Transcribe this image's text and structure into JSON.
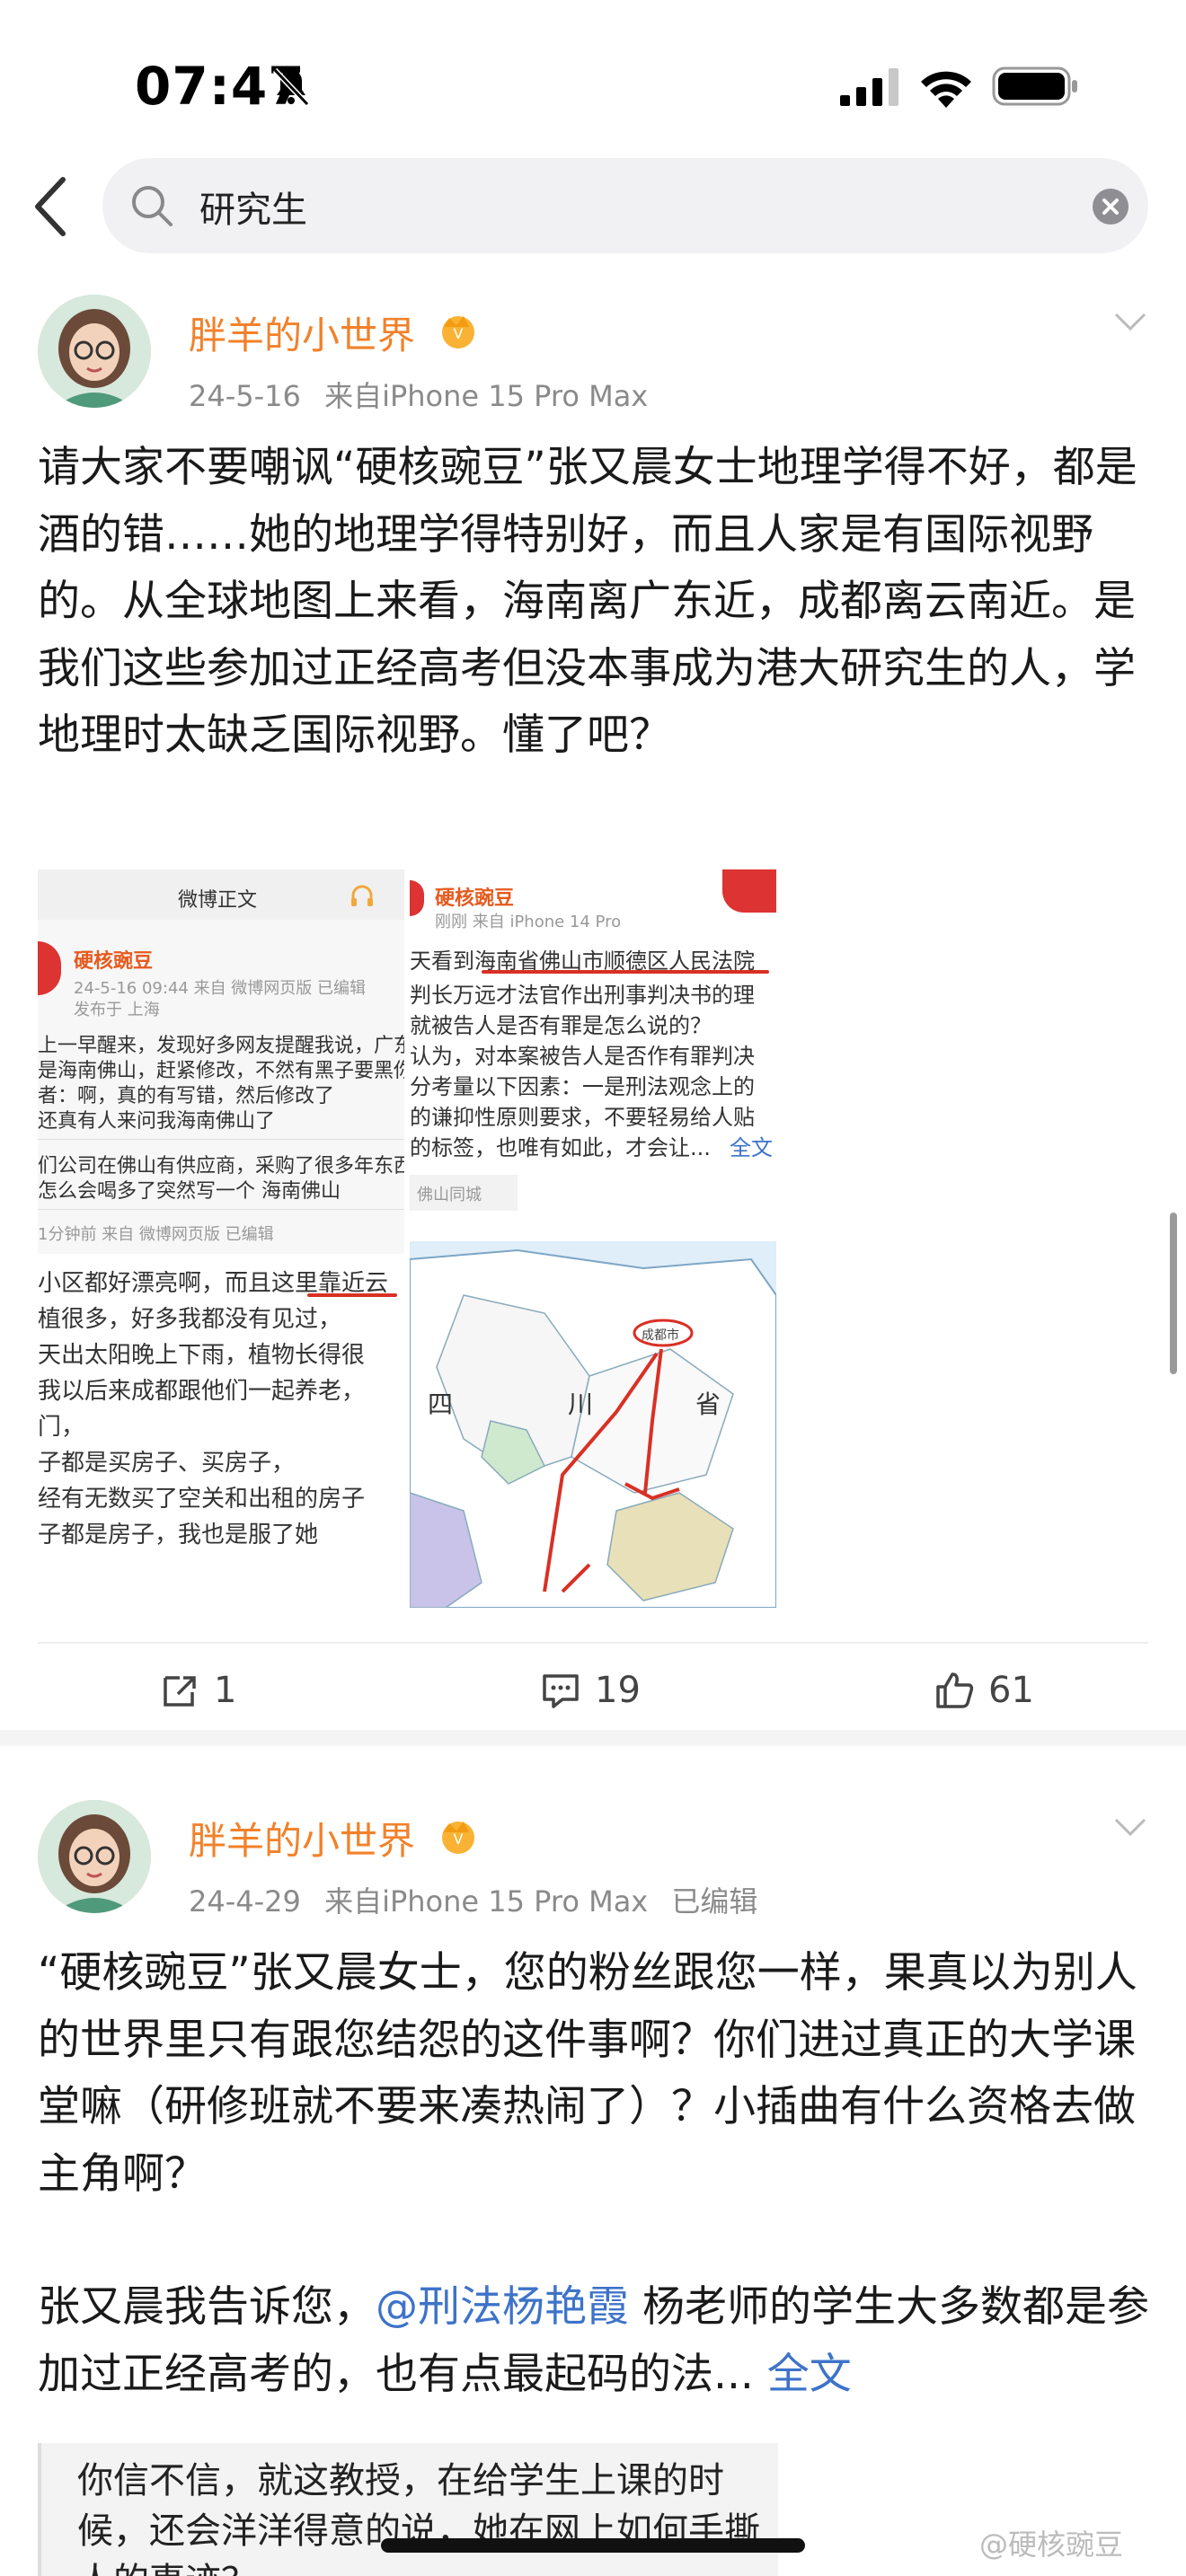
{
  "status_bar": {
    "time": "07:47"
  },
  "search": {
    "query": "研究生"
  },
  "posts": [
    {
      "username": "胖羊的小世界",
      "date": "24-5-16",
      "source": "来自iPhone 15 Pro Max",
      "edited": "",
      "text": "请大家不要嘲讽“硬核豌豆”张又晨女士地理学得不好，都是酒的错……她的地理学得特别好，而且人家是有国际视野的。从全球地图上来看，海南离广东近，成都离云南近。是我们这些参加过正经高考但没本事成为港大研究生的人，学地理时太缺乏国际视野。懂了吧？",
      "images": {
        "left_header": "微博正文",
        "left_user": "硬核豌豆",
        "left_meta": "24-5-16 09:44  来自 微博网页版  已编辑",
        "left_meta2": "发布于 上海",
        "left_lines": [
          "上一早醒来，发现好多网友提醒我说，广东佛山",
          "是海南佛山，赶紧修改，不然有黑子要黑你了。",
          "者：啊，真的有写错，然后修改了",
          "还真有人来问我海南佛山了"
        ],
        "left_lines2": [
          "们公司在佛山有供应商，采购了很多年东西，我",
          "怎么会喝多了突然写一个 海南佛山"
        ],
        "left_meta3": "1分钟前  来自 微博网页版  已编辑",
        "left_lines3": [
          "小区都好漂亮啊，而且这里靠近云",
          "植很多，好多我都没有见过，",
          "天出太阳晚上下雨，植物长得很",
          "我以后来成都跟他们一起养老，",
          "门，",
          "子都是买房子、买房子，",
          "经有无数买了空关和出租的房子",
          "子都是房子，我也是服了她"
        ],
        "right_user": "硬核豌豆",
        "right_meta": "刚刚  来自 iPhone 14 Pro",
        "right_lines": [
          "天看到海南省佛山市顺德区人民法院",
          "判长万远才法官作出刑事判决书的理",
          "就被告人是否有罪是怎么说的？",
          "认为，对本案被告人是否作有罪判决",
          "分考量以下因素：一是刑法观念上的",
          "的谦抑性原则要求，不要轻易给人贴",
          "的标签，也唯有如此，才会让..."
        ],
        "right_more": "全文",
        "right_loc": "佛山同城",
        "map_labels": [
          "四",
          "川",
          "省",
          "成都市"
        ]
      },
      "actions": {
        "repost": "1",
        "comment": "19",
        "like": "61"
      }
    },
    {
      "username": "胖羊的小世界",
      "date": "24-4-29",
      "source": "来自iPhone 15 Pro Max",
      "edited": "已编辑",
      "text_part1": "“硬核豌豆”张又晨女士，您的粉丝跟您一样，果真以为别人的世界里只有跟您结怨的这件事啊？你们进过真正的大学课堂嘛（研修班就不要来凑热闹了）？小插曲有什么资格去做主角啊？",
      "text_part2_prefix": "张又晨我告诉您，",
      "mention": "@刑法杨艳霞",
      "text_part2_suffix": " 杨老师的学生大多数都是参加过正经高考的，也有点最起码的法...",
      "more": "全文",
      "quote": "你信不信，就这教授，在给学生上课的时候，还会洋洋得意的说，她在网上如何手撕人的事迹？"
    }
  ],
  "watermark": "@硬核豌豆",
  "colors": {
    "username": "#f2812a",
    "link": "#3d73c9",
    "annotation_red": "#d93025"
  }
}
